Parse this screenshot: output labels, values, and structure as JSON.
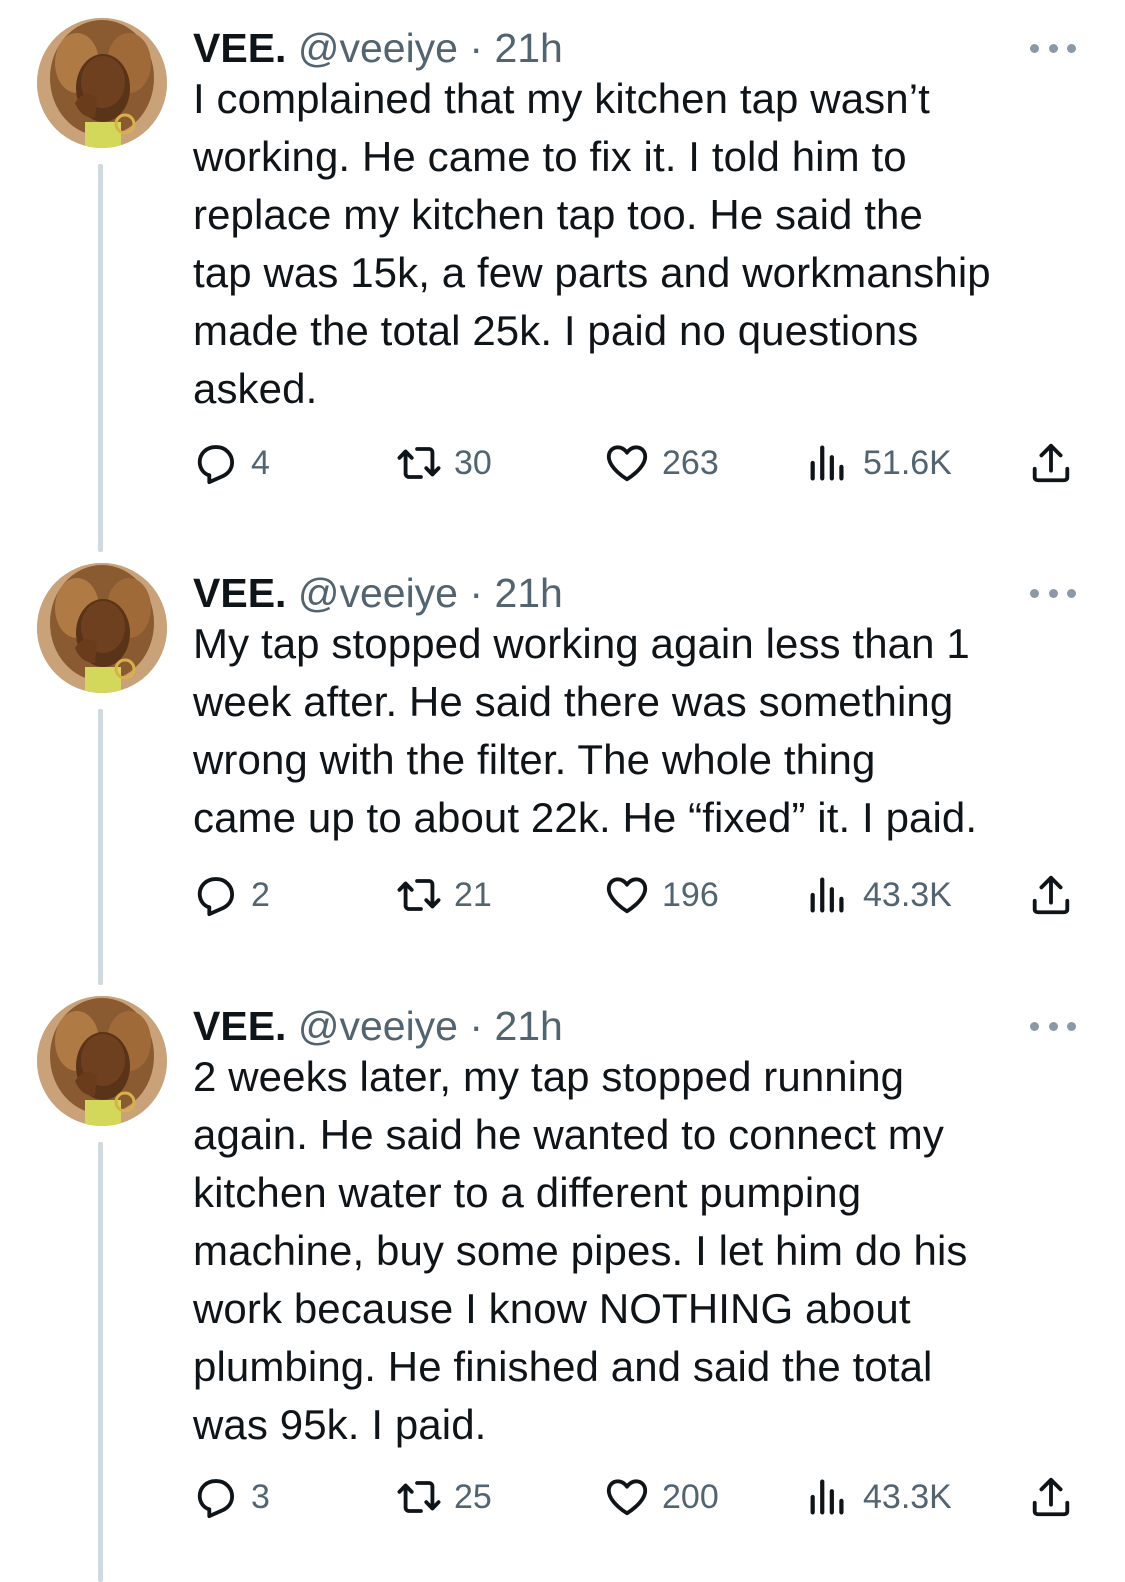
{
  "tweets": [
    {
      "author": {
        "display_name": "VEE.",
        "handle": "@veeiye",
        "separator": "·",
        "time": "21h"
      },
      "text": "I complained that my kitchen tap wasn’t\nworking. He came to fix it. I told him to\nreplace my kitchen tap too. He said the\ntap was 15k, a few parts and workmanship\nmade the total 25k. I paid no questions\nasked.",
      "stats": {
        "replies": "4",
        "retweets": "30",
        "likes": "263",
        "views": "51.6K"
      }
    },
    {
      "author": {
        "display_name": "VEE.",
        "handle": "@veeiye",
        "separator": "·",
        "time": "21h"
      },
      "text": "My tap stopped working again less than 1\nweek after. He said there was something\nwrong with the filter. The whole thing\ncame up to about 22k. He “fixed” it. I paid.",
      "stats": {
        "replies": "2",
        "retweets": "21",
        "likes": "196",
        "views": "43.3K"
      }
    },
    {
      "author": {
        "display_name": "VEE.",
        "handle": "@veeiye",
        "separator": "·",
        "time": "21h"
      },
      "text": "2 weeks later, my tap stopped running\nagain. He said he wanted to connect my\nkitchen water to a different pumping\nmachine, buy some pipes. I let him do his\nwork because I know NOTHING about\nplumbing. He finished and said the total\nwas 95k. I paid.",
      "stats": {
        "replies": "3",
        "retweets": "25",
        "likes": "200",
        "views": "43.3K"
      }
    }
  ],
  "icons": {
    "reply": "reply-icon",
    "retweet": "retweet-icon",
    "like": "heart-icon",
    "views": "views-icon",
    "share": "share-icon",
    "more": "more-icon"
  },
  "colors": {
    "text": "#0f1419",
    "secondary": "#536471",
    "thread_line": "#cfd9de",
    "background": "#ffffff"
  }
}
